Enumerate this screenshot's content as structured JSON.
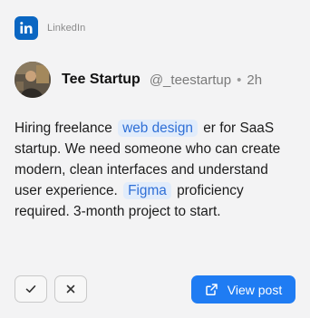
{
  "source": {
    "name": "LinkedIn",
    "icon": "linkedin-icon",
    "color": "#0a66c2"
  },
  "author": {
    "name": "Tee Startup",
    "handle": "@_teestartup",
    "separator": "•",
    "time": "2h"
  },
  "post": {
    "line1_pre": "Hiring freelance",
    "highlight1": "web design",
    "line1_post": "er for",
    "body_mid": "SaaS startup. We need someone who can create modern, clean interfaces and understand user experience.",
    "highlight2": "Figma",
    "body_end": "proficiency required. 3-month project to start.",
    "highlight_color": "#2f6fd6"
  },
  "actions": {
    "approve_icon": "check-icon",
    "dismiss_icon": "close-icon",
    "view_label": "View post",
    "view_icon": "external-link-icon",
    "accent": "#1f7cf3"
  }
}
